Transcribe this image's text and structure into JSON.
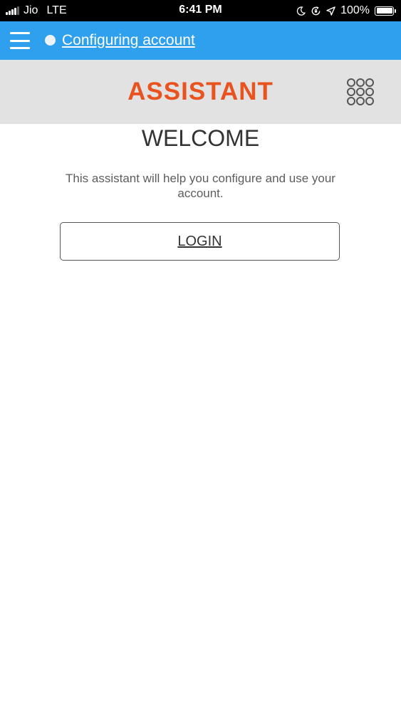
{
  "status_bar": {
    "carrier": "Jio",
    "network": "LTE",
    "time": "6:41 PM",
    "battery": "100%",
    "signal_bars": 4,
    "signal_bars_total": 5,
    "icons": [
      "signal-icon",
      "moon-icon",
      "orientation-lock-icon",
      "location-icon",
      "battery-icon"
    ]
  },
  "app_bar": {
    "title": "Configuring account",
    "color": "#2fa0ee",
    "icons": [
      "menu-icon",
      "status-dot-icon"
    ]
  },
  "assistant_header": {
    "title": "ASSISTANT",
    "title_color": "#e9531f",
    "icons": [
      "dialpad-icon"
    ]
  },
  "content": {
    "welcome_title": "WELCOME",
    "welcome_text": "This assistant will help you configure and use your account.",
    "login_label": "LOGIN"
  }
}
